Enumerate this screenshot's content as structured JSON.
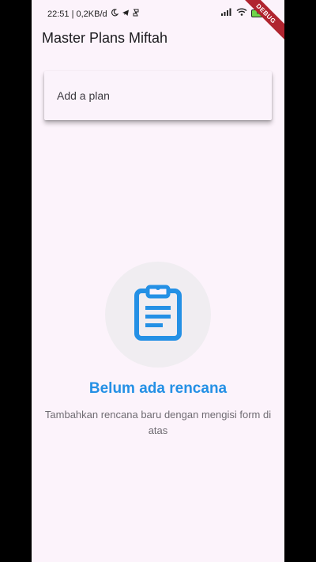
{
  "status_bar": {
    "time_speed": "22:51 | 0,2KB/d",
    "battery": "68"
  },
  "debug_banner": "DEBUG",
  "app_bar": {
    "title": "Master Plans Miftah"
  },
  "plan_input": {
    "placeholder": "Add a plan"
  },
  "empty_state": {
    "icon": "clipboard-icon",
    "title": "Belum ada rencana",
    "subtitle": "Tambahkan rencana baru dengan mengisi form di atas"
  },
  "colors": {
    "background": "#fcf3fb",
    "accent": "#2490e5",
    "subtitle": "#6f6b72"
  }
}
